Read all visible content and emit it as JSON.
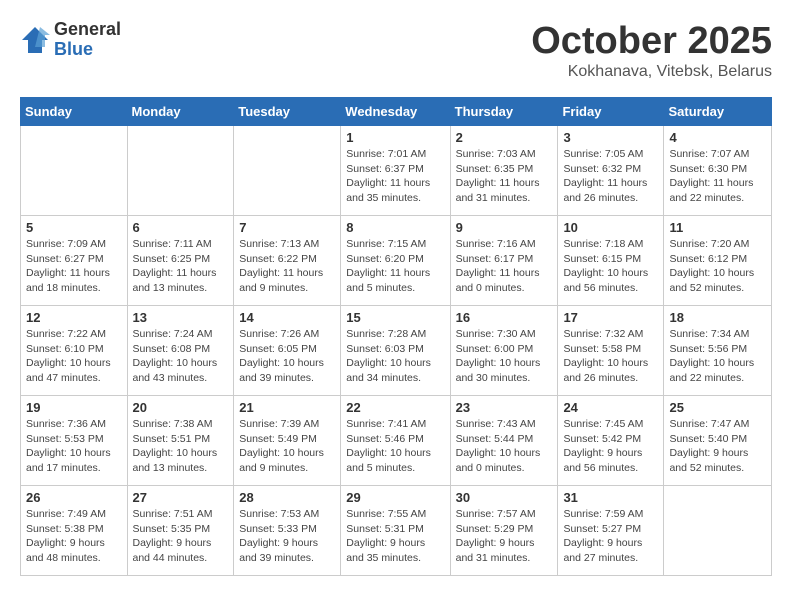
{
  "header": {
    "logo_general": "General",
    "logo_blue": "Blue",
    "month_title": "October 2025",
    "subtitle": "Kokhanava, Vitebsk, Belarus"
  },
  "days_of_week": [
    "Sunday",
    "Monday",
    "Tuesday",
    "Wednesday",
    "Thursday",
    "Friday",
    "Saturday"
  ],
  "weeks": [
    [
      {
        "day": "",
        "info": ""
      },
      {
        "day": "",
        "info": ""
      },
      {
        "day": "",
        "info": ""
      },
      {
        "day": "1",
        "info": "Sunrise: 7:01 AM\nSunset: 6:37 PM\nDaylight: 11 hours\nand 35 minutes."
      },
      {
        "day": "2",
        "info": "Sunrise: 7:03 AM\nSunset: 6:35 PM\nDaylight: 11 hours\nand 31 minutes."
      },
      {
        "day": "3",
        "info": "Sunrise: 7:05 AM\nSunset: 6:32 PM\nDaylight: 11 hours\nand 26 minutes."
      },
      {
        "day": "4",
        "info": "Sunrise: 7:07 AM\nSunset: 6:30 PM\nDaylight: 11 hours\nand 22 minutes."
      }
    ],
    [
      {
        "day": "5",
        "info": "Sunrise: 7:09 AM\nSunset: 6:27 PM\nDaylight: 11 hours\nand 18 minutes."
      },
      {
        "day": "6",
        "info": "Sunrise: 7:11 AM\nSunset: 6:25 PM\nDaylight: 11 hours\nand 13 minutes."
      },
      {
        "day": "7",
        "info": "Sunrise: 7:13 AM\nSunset: 6:22 PM\nDaylight: 11 hours\nand 9 minutes."
      },
      {
        "day": "8",
        "info": "Sunrise: 7:15 AM\nSunset: 6:20 PM\nDaylight: 11 hours\nand 5 minutes."
      },
      {
        "day": "9",
        "info": "Sunrise: 7:16 AM\nSunset: 6:17 PM\nDaylight: 11 hours\nand 0 minutes."
      },
      {
        "day": "10",
        "info": "Sunrise: 7:18 AM\nSunset: 6:15 PM\nDaylight: 10 hours\nand 56 minutes."
      },
      {
        "day": "11",
        "info": "Sunrise: 7:20 AM\nSunset: 6:12 PM\nDaylight: 10 hours\nand 52 minutes."
      }
    ],
    [
      {
        "day": "12",
        "info": "Sunrise: 7:22 AM\nSunset: 6:10 PM\nDaylight: 10 hours\nand 47 minutes."
      },
      {
        "day": "13",
        "info": "Sunrise: 7:24 AM\nSunset: 6:08 PM\nDaylight: 10 hours\nand 43 minutes."
      },
      {
        "day": "14",
        "info": "Sunrise: 7:26 AM\nSunset: 6:05 PM\nDaylight: 10 hours\nand 39 minutes."
      },
      {
        "day": "15",
        "info": "Sunrise: 7:28 AM\nSunset: 6:03 PM\nDaylight: 10 hours\nand 34 minutes."
      },
      {
        "day": "16",
        "info": "Sunrise: 7:30 AM\nSunset: 6:00 PM\nDaylight: 10 hours\nand 30 minutes."
      },
      {
        "day": "17",
        "info": "Sunrise: 7:32 AM\nSunset: 5:58 PM\nDaylight: 10 hours\nand 26 minutes."
      },
      {
        "day": "18",
        "info": "Sunrise: 7:34 AM\nSunset: 5:56 PM\nDaylight: 10 hours\nand 22 minutes."
      }
    ],
    [
      {
        "day": "19",
        "info": "Sunrise: 7:36 AM\nSunset: 5:53 PM\nDaylight: 10 hours\nand 17 minutes."
      },
      {
        "day": "20",
        "info": "Sunrise: 7:38 AM\nSunset: 5:51 PM\nDaylight: 10 hours\nand 13 minutes."
      },
      {
        "day": "21",
        "info": "Sunrise: 7:39 AM\nSunset: 5:49 PM\nDaylight: 10 hours\nand 9 minutes."
      },
      {
        "day": "22",
        "info": "Sunrise: 7:41 AM\nSunset: 5:46 PM\nDaylight: 10 hours\nand 5 minutes."
      },
      {
        "day": "23",
        "info": "Sunrise: 7:43 AM\nSunset: 5:44 PM\nDaylight: 10 hours\nand 0 minutes."
      },
      {
        "day": "24",
        "info": "Sunrise: 7:45 AM\nSunset: 5:42 PM\nDaylight: 9 hours\nand 56 minutes."
      },
      {
        "day": "25",
        "info": "Sunrise: 7:47 AM\nSunset: 5:40 PM\nDaylight: 9 hours\nand 52 minutes."
      }
    ],
    [
      {
        "day": "26",
        "info": "Sunrise: 7:49 AM\nSunset: 5:38 PM\nDaylight: 9 hours\nand 48 minutes."
      },
      {
        "day": "27",
        "info": "Sunrise: 7:51 AM\nSunset: 5:35 PM\nDaylight: 9 hours\nand 44 minutes."
      },
      {
        "day": "28",
        "info": "Sunrise: 7:53 AM\nSunset: 5:33 PM\nDaylight: 9 hours\nand 39 minutes."
      },
      {
        "day": "29",
        "info": "Sunrise: 7:55 AM\nSunset: 5:31 PM\nDaylight: 9 hours\nand 35 minutes."
      },
      {
        "day": "30",
        "info": "Sunrise: 7:57 AM\nSunset: 5:29 PM\nDaylight: 9 hours\nand 31 minutes."
      },
      {
        "day": "31",
        "info": "Sunrise: 7:59 AM\nSunset: 5:27 PM\nDaylight: 9 hours\nand 27 minutes."
      },
      {
        "day": "",
        "info": ""
      }
    ]
  ]
}
